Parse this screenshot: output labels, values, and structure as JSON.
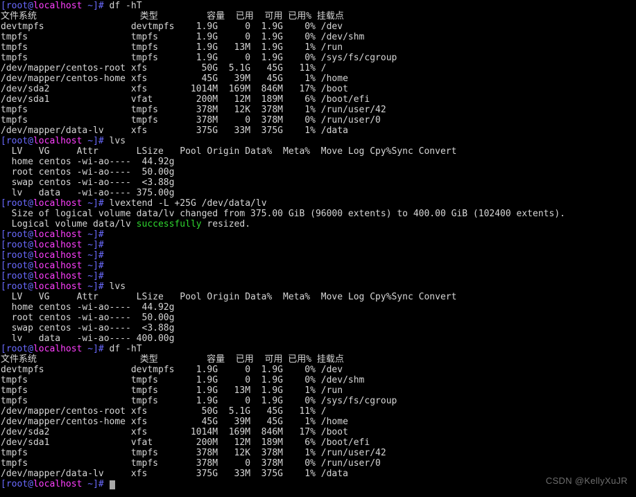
{
  "terminal": {
    "shell": "bash",
    "colors": {
      "background": "#000000",
      "foreground": "#d6d6d6",
      "prompt_user": "#6a6aff",
      "prompt_host": "#ff3fff",
      "success": "#2fd72f",
      "cursor": "#a9a9a9",
      "watermark": "#6e6e6e"
    },
    "prompt": {
      "open_bracket": "[",
      "user": "root",
      "at": "@",
      "host": "localhost",
      "tail": " ~]#"
    }
  },
  "watermark": {
    "text": "CSDN @KellyXuJR"
  },
  "commands": {
    "df": "df -hT",
    "lvs": "lvs",
    "lvextend": "lvextend -L +25G /dev/data/lv"
  },
  "df_table": {
    "headers": [
      "文件系统",
      "类型",
      "容量",
      "已用",
      "可用",
      "已用%",
      "挂载点"
    ],
    "header_line": "文件系统                   类型         容量  已用  可用 已用% 挂载点",
    "rows_before": [
      "devtmpfs                devtmpfs    1.9G     0  1.9G    0% /dev",
      "tmpfs                   tmpfs       1.9G     0  1.9G    0% /dev/shm",
      "tmpfs                   tmpfs       1.9G   13M  1.9G    1% /run",
      "tmpfs                   tmpfs       1.9G     0  1.9G    0% /sys/fs/cgroup",
      "/dev/mapper/centos-root xfs          50G  5.1G   45G   11% /",
      "/dev/mapper/centos-home xfs          45G   39M   45G    1% /home",
      "/dev/sda2               xfs        1014M  169M  846M   17% /boot",
      "/dev/sda1               vfat        200M   12M  189M    6% /boot/efi",
      "tmpfs                   tmpfs       378M   12K  378M    1% /run/user/42",
      "tmpfs                   tmpfs       378M     0  378M    0% /run/user/0",
      "/dev/mapper/data-lv     xfs         375G   33M  375G    1% /data"
    ],
    "rows_after": [
      "devtmpfs                devtmpfs    1.9G     0  1.9G    0% /dev",
      "tmpfs                   tmpfs       1.9G     0  1.9G    0% /dev/shm",
      "tmpfs                   tmpfs       1.9G   13M  1.9G    1% /run",
      "tmpfs                   tmpfs       1.9G     0  1.9G    0% /sys/fs/cgroup",
      "/dev/mapper/centos-root xfs          50G  5.1G   45G   11% /",
      "/dev/mapper/centos-home xfs          45G   39M   45G    1% /home",
      "/dev/sda2               xfs        1014M  169M  846M   17% /boot",
      "/dev/sda1               vfat        200M   12M  189M    6% /boot/efi",
      "tmpfs                   tmpfs       378M   12K  378M    1% /run/user/42",
      "tmpfs                   tmpfs       378M     0  378M    0% /run/user/0",
      "/dev/mapper/data-lv     xfs         375G   33M  375G    1% /data"
    ]
  },
  "lvs_table": {
    "header_line": "  LV   VG     Attr       LSize   Pool Origin Data%  Meta%  Move Log Cpy%Sync Convert",
    "rows_before": [
      "  home centos -wi-ao----  44.92g",
      "  root centos -wi-ao----  50.00g",
      "  swap centos -wi-ao----  <3.88g",
      "  lv   data   -wi-ao---- 375.00g"
    ],
    "rows_after": [
      "  home centos -wi-ao----  44.92g",
      "  root centos -wi-ao----  50.00g",
      "  swap centos -wi-ao----  <3.88g",
      "  lv   data   -wi-ao---- 400.00g"
    ]
  },
  "lvextend_output": {
    "size_line": "  Size of logical volume data/lv changed from 375.00 GiB (96000 extents) to 400.00 GiB (102400 extents).",
    "resized_prefix": "  Logical volume data/lv ",
    "resized_keyword": "successfully",
    "resized_suffix": " resized."
  },
  "blank_prompt_count": 5
}
